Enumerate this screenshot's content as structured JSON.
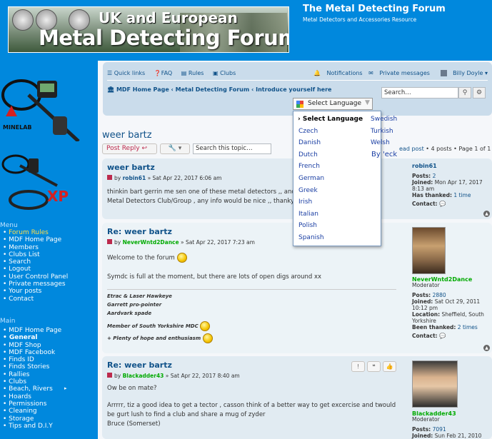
{
  "header": {
    "banner_line1": "UK and European",
    "banner_line2": "Metal Detecting Forum",
    "site_title": "The Metal Detecting Forum",
    "site_desc": "Metal Detectors and Accessories Resource"
  },
  "sidebar": {
    "brand_minelab": "MINELAB",
    "brand_xp": "XP",
    "menu_heading": "Menu",
    "menu": [
      "Forum Rules",
      "MDF Home Page",
      "Members",
      "Clubs List",
      "Search",
      "Logout",
      "User Control Panel",
      "Private messages",
      "Your posts",
      "Contact"
    ],
    "main_heading": "Main",
    "main": [
      "MDF Home Page",
      "General",
      "MDF Shop",
      "MDF Facebook",
      "Finds ID",
      "Finds Stories",
      "Rallies",
      "Clubs",
      "Beach, Rivers",
      "Hoards",
      "Permissions",
      "Cleaning",
      "Storage",
      "Tips and D.I.Y"
    ]
  },
  "navbar": {
    "quick_links": "Quick links",
    "faq": "FAQ",
    "rules": "Rules",
    "clubs": "Clubs",
    "notifications": "Notifications",
    "private_messages": "Private messages",
    "username": "Billy Doyle",
    "breadcrumbs": [
      "MDF Home Page",
      "Metal Detecting Forum",
      "Introduce yourself here"
    ],
    "search_placeholder": "Search…"
  },
  "translate": {
    "label": "Select Language",
    "options_col1": [
      "Select Language",
      "Czech",
      "Danish",
      "Dutch",
      "French",
      "German",
      "Greek",
      "Irish",
      "Italian",
      "Polish",
      "Spanish"
    ],
    "options_col2": [
      "Swedish",
      "Turkish",
      "Welsh",
      "By 'eck"
    ]
  },
  "topic": {
    "title": "weer bartz",
    "post_reply": "Post Reply",
    "search_placeholder": "Search this topic…",
    "page_info_link": "ead post",
    "page_info": "• 4 posts • Page 1 of 1"
  },
  "posts": [
    {
      "title": "weer bartz",
      "by": "by",
      "author": "robin61",
      "date": "» Sat Apr 22, 2017 6:06 am",
      "lines": [
        "thinkin bart gerrin me sen one of these metal detectors ,, and",
        "Metal Detectors Club/Group , any info would be nice ,, thanky"
      ],
      "profile": {
        "name": "robin61",
        "rows": [
          [
            "Posts:",
            "2"
          ],
          [
            "Joined:",
            "Mon Apr 17, 2017"
          ],
          [
            "",
            "8:13 am"
          ],
          [
            "Has thanked:",
            "1 time"
          ],
          [
            "Contact:",
            ""
          ]
        ]
      }
    },
    {
      "title": "Re: weer bartz",
      "by": "by",
      "author": "NeverWntd2Dance",
      "date": "» Sat Apr 22, 2017 7:23 am",
      "lines": [
        "Welcome to the forum",
        "Symdc is full at the moment, but there are lots of open digs around xx"
      ],
      "signature": [
        "Etrac & Laser Hawkeye",
        "Garrett pro-pointer",
        "Aardvark spade",
        "Member of South Yorkshire MDC",
        "+ Plenty of hope and enthusiasm"
      ],
      "profile": {
        "name": "NeverWntd2Dance",
        "role": "Moderator",
        "rows": [
          [
            "Posts:",
            "2880"
          ],
          [
            "Joined:",
            "Sat Oct 29, 2011"
          ],
          [
            "",
            "10:12 pm"
          ],
          [
            "Location:",
            "Sheffield, South"
          ],
          [
            "",
            "Yorkshire"
          ],
          [
            "Been thanked:",
            "2 times"
          ],
          [
            "Contact:",
            ""
          ]
        ]
      }
    },
    {
      "title": "Re: weer bartz",
      "by": "by",
      "author": "Blackadder43",
      "date": "» Sat Apr 22, 2017 8:40 am",
      "lines": [
        "Ow be on mate?",
        "Arrrrr, tiz a good idea to get a tector , casson think of a better way to get excercise and twould",
        "be gurt lush to find a club and share a mug of zyder",
        "Bruce (Somerset)"
      ],
      "profile": {
        "name": "Blackadder43",
        "role": "Moderator",
        "rows": [
          [
            "Posts:",
            "7091"
          ],
          [
            "Joined:",
            "Sun Feb 21, 2010"
          ]
        ]
      }
    }
  ],
  "colors": {
    "brand_blue": "#0088dd",
    "link": "#105289",
    "author_green": "#00aa00",
    "reply_red": "#bc2a4d"
  }
}
